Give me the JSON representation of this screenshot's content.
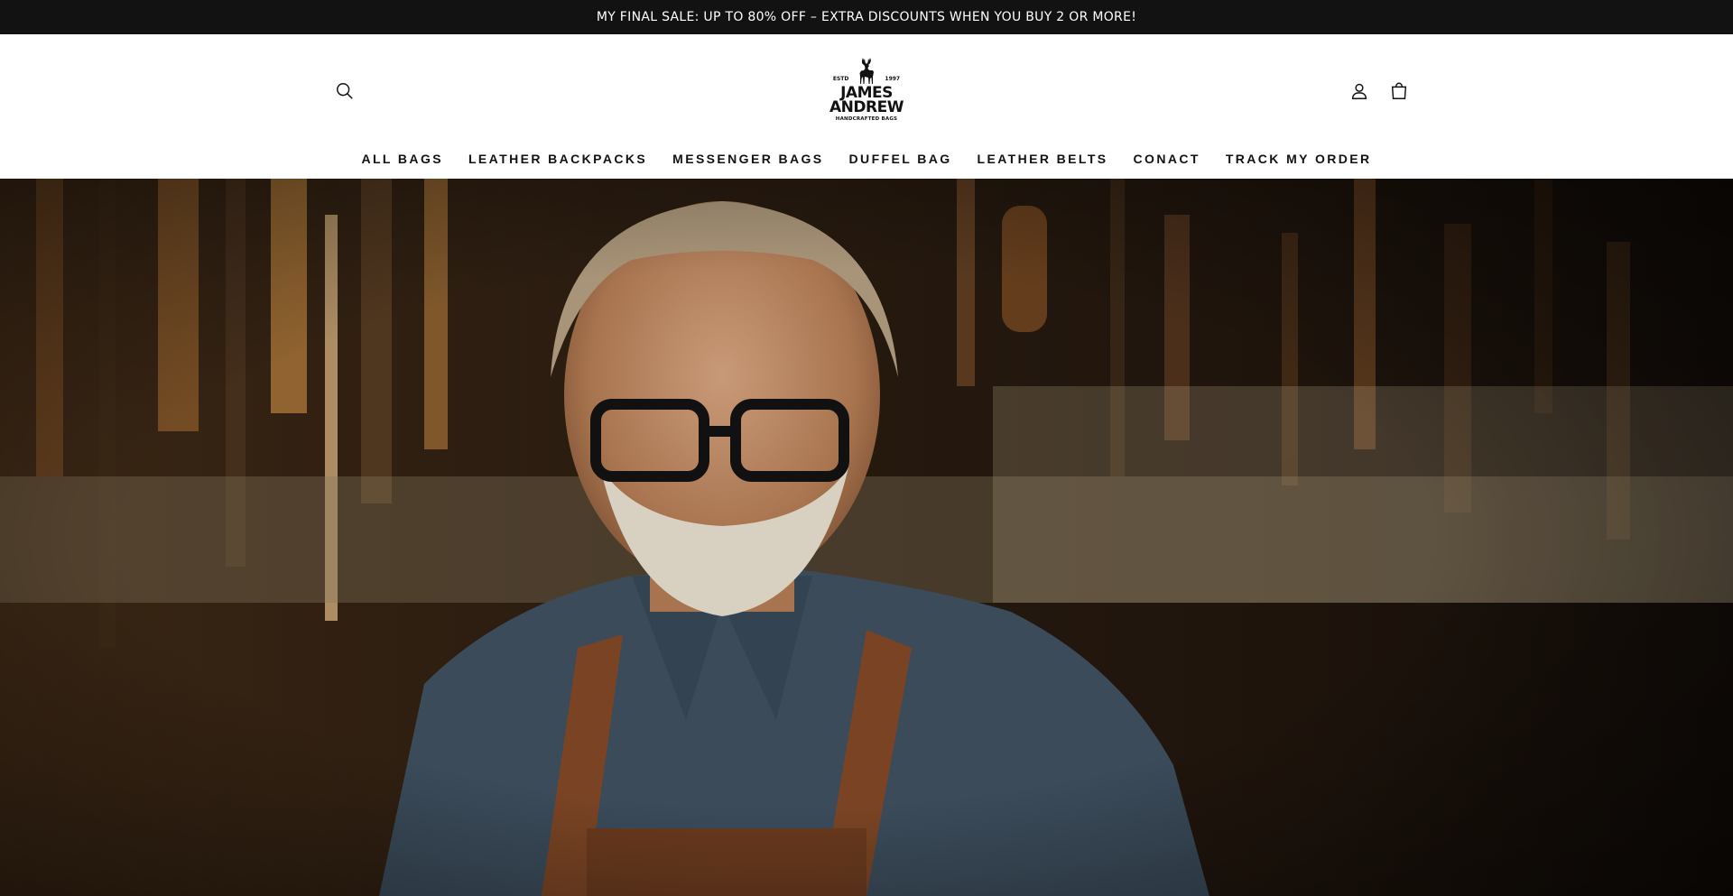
{
  "announcement": {
    "text": "MY FINAL SALE: UP TO 80% OFF – EXTRA DISCOUNTS WHEN YOU BUY 2 OR MORE!"
  },
  "header": {
    "search_icon": "search-icon",
    "account_icon": "user-icon",
    "cart_icon": "cart-icon"
  },
  "logo": {
    "estd": "ESTD",
    "year": "1997",
    "line1": "JAMES",
    "line2": "ANDREW",
    "tagline": "HANDCRAFTED BAGS"
  },
  "nav": {
    "items": [
      {
        "label": "ALL BAGS"
      },
      {
        "label": "LEATHER BACKPACKS"
      },
      {
        "label": "MESSENGER BAGS"
      },
      {
        "label": "DUFFEL BAG"
      },
      {
        "label": "LEATHER BELTS"
      },
      {
        "label": "CONACT"
      },
      {
        "label": "TRACK MY ORDER"
      }
    ]
  },
  "hero": {
    "image": "craftsman-portrait-in-workshop"
  },
  "colors": {
    "announcement_bg": "#121212",
    "text": "#121212",
    "background": "#ffffff"
  }
}
